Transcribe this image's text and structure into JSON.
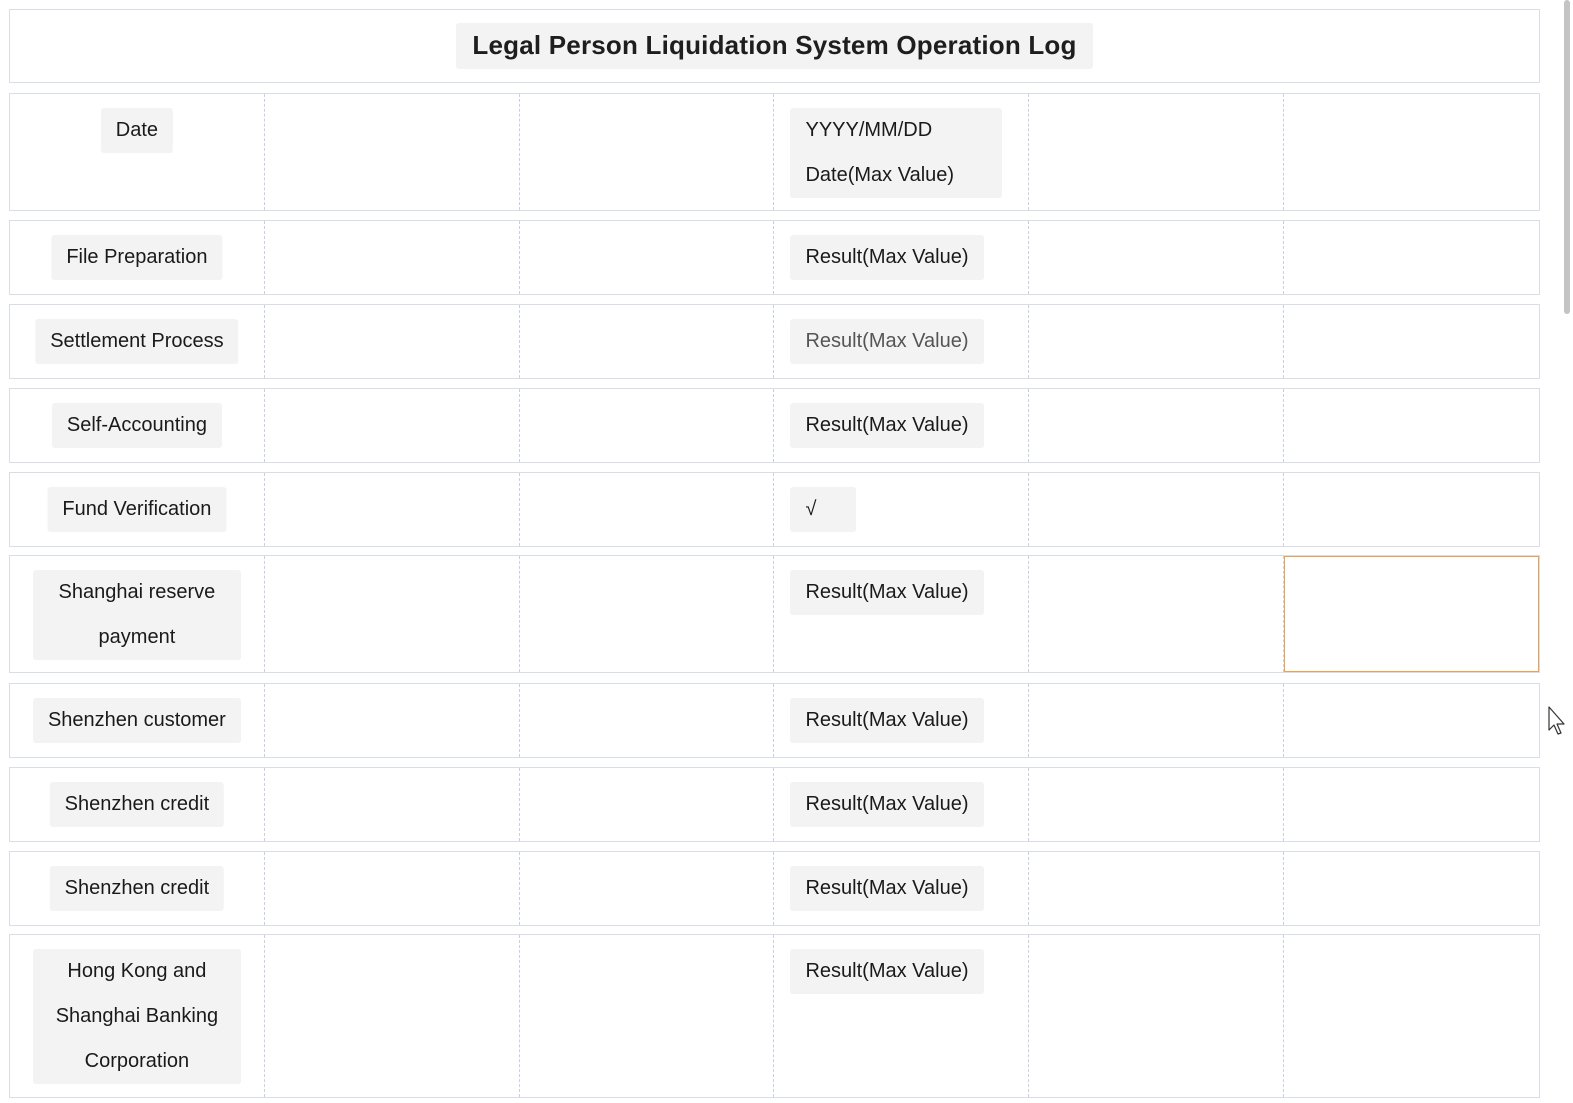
{
  "title": "Legal Person Liquidation System Operation Log",
  "rows": [
    {
      "label": "Date",
      "value_lines": [
        "YYYY/MM/DD",
        "Date(Max Value)"
      ]
    },
    {
      "label": "File Preparation",
      "value": "Result(Max Value)"
    },
    {
      "label": "Settlement Process",
      "value": "Result(Max Value)"
    },
    {
      "label": "Self-Accounting",
      "value": "Result(Max Value)"
    },
    {
      "label": "Fund Verification",
      "value": "√"
    },
    {
      "label": "Shanghai reserve payment",
      "value": "Result(Max Value)"
    },
    {
      "label": "Shenzhen customer",
      "value": "Result(Max Value)"
    },
    {
      "label": "Shenzhen credit",
      "value": "Result(Max Value)"
    },
    {
      "label": "Shenzhen credit",
      "value": "Result(Max Value)"
    },
    {
      "label": "Hong Kong and Shanghai Banking Corporation",
      "value": "Result(Max Value)"
    }
  ],
  "colors": {
    "selection_border": "#f0a24b",
    "chip_background": "#f3f3f3",
    "grid_line": "#d9dde6"
  }
}
